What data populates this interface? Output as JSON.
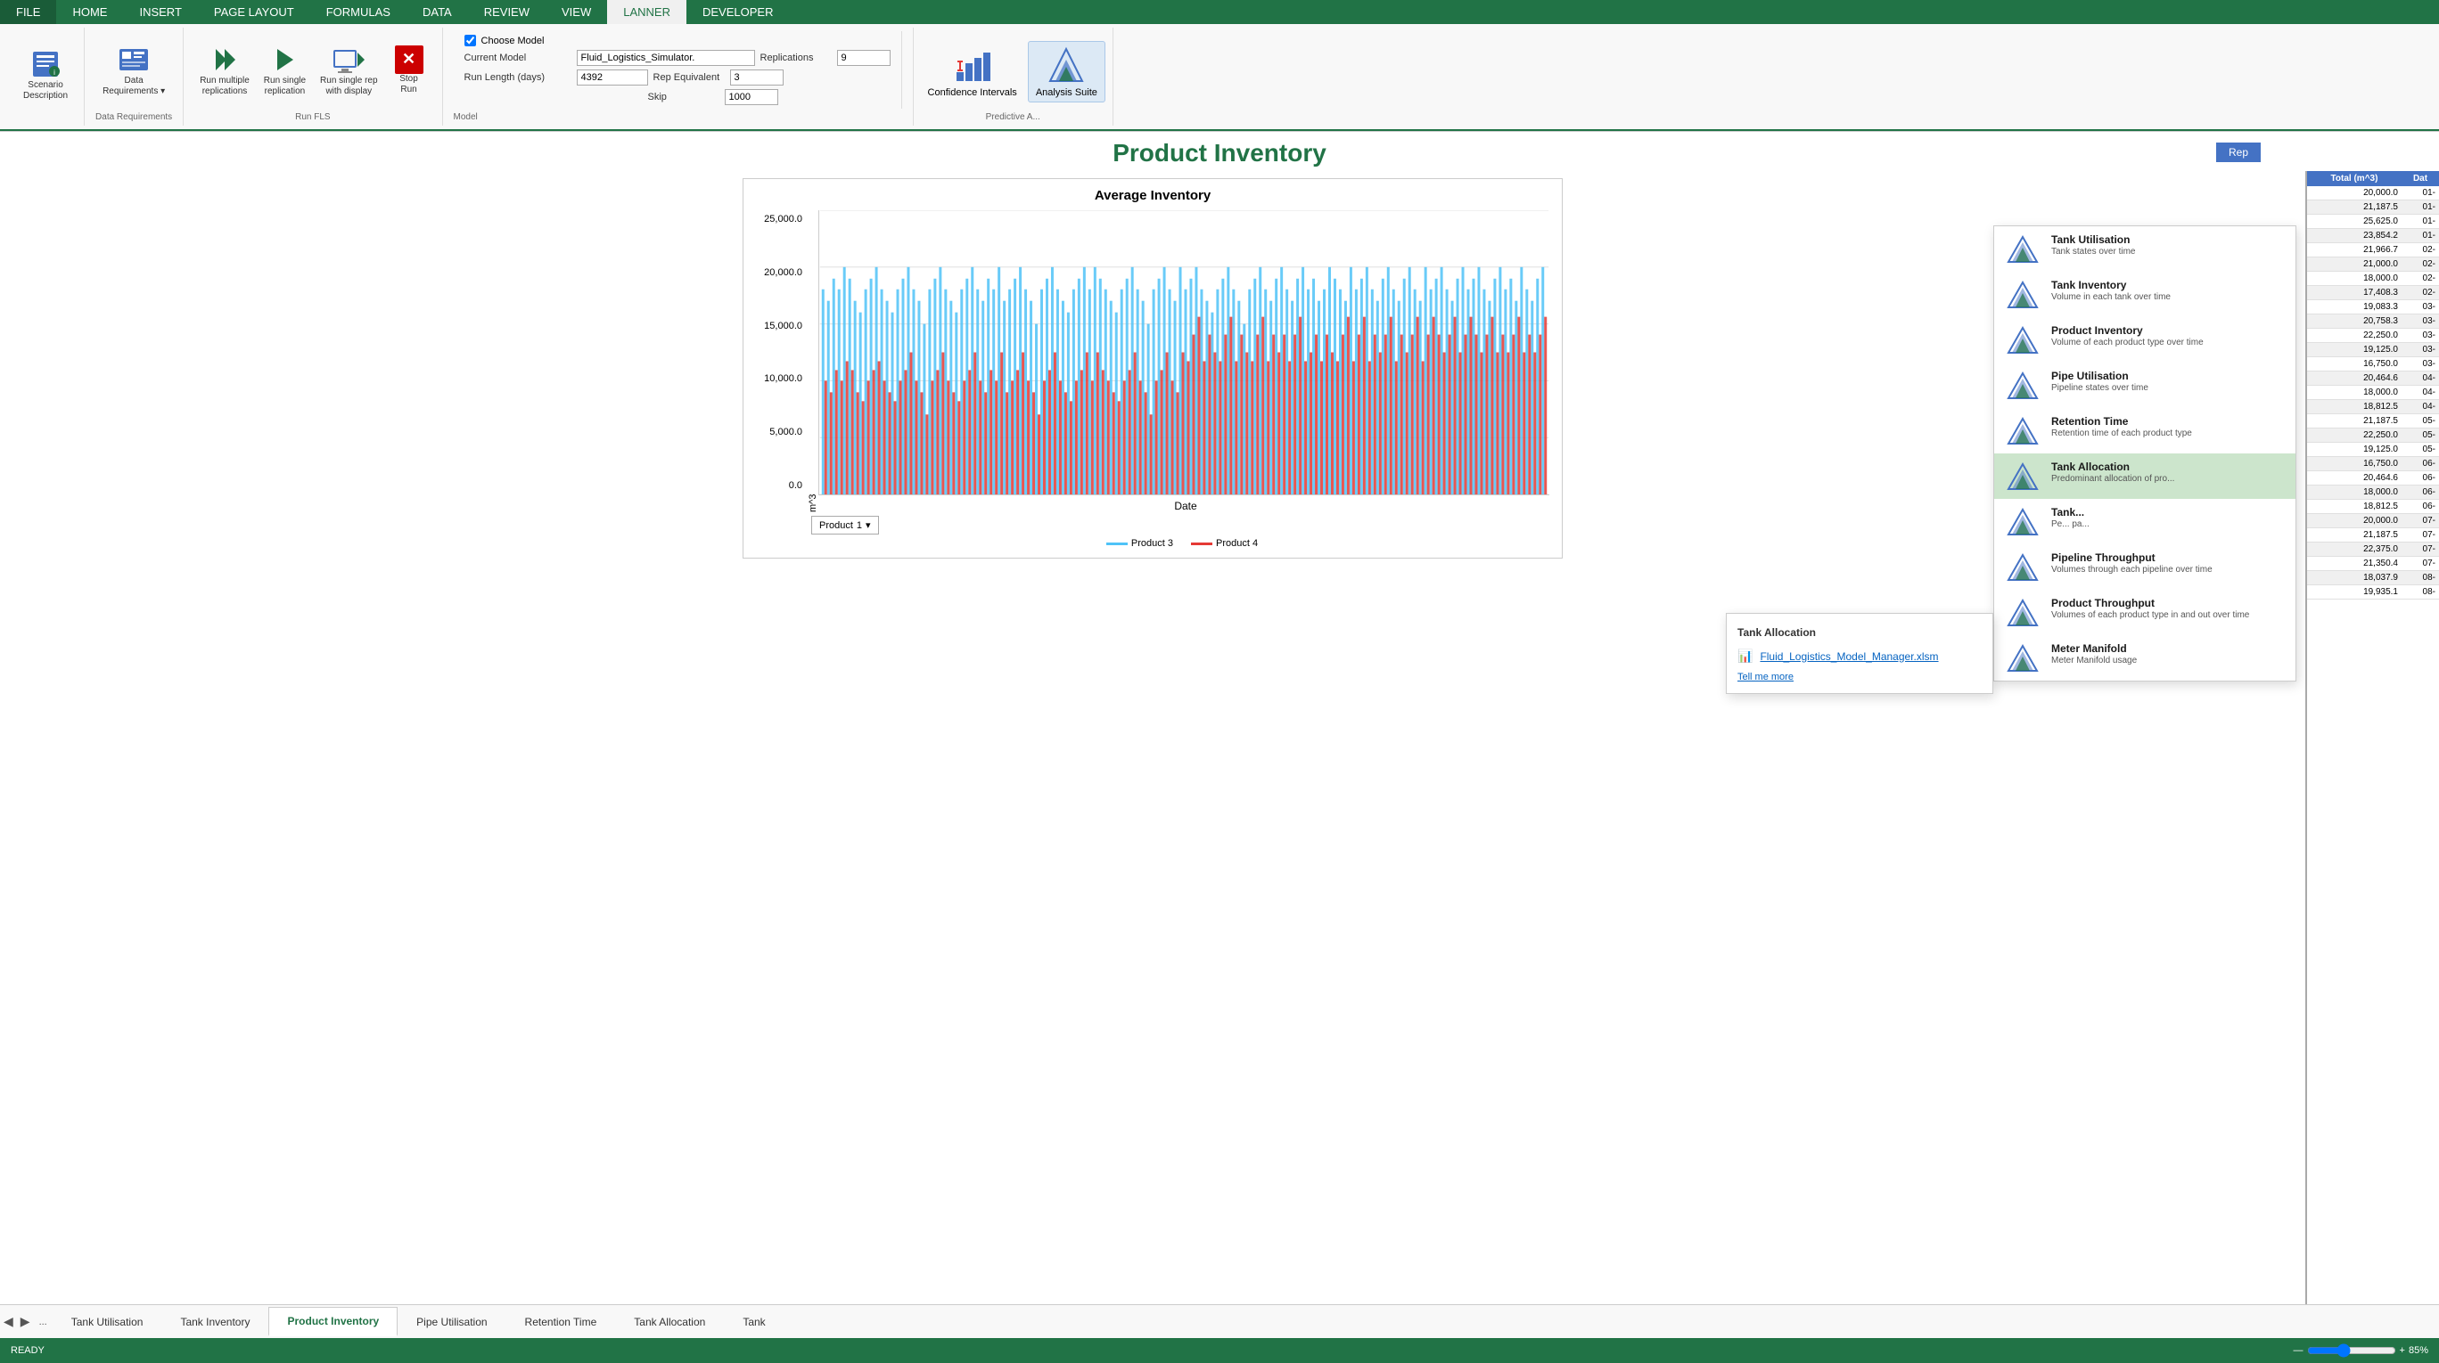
{
  "ribbon": {
    "tabs": [
      "FILE",
      "HOME",
      "INSERT",
      "PAGE LAYOUT",
      "FORMULAS",
      "DATA",
      "REVIEW",
      "VIEW",
      "LANNER",
      "DEVELOPER"
    ],
    "active_tab": "LANNER",
    "groups": {
      "scenario": {
        "label": "Scenario\nDescription",
        "group_label": ""
      },
      "data_req": {
        "label": "Data\nRequirements",
        "group_label": "Data Requirements"
      },
      "run_fls": {
        "buttons": [
          "Run multiple\nreplications",
          "Run single\nreplication",
          "Run single rep\nwith display",
          "Stop\nRun"
        ],
        "group_label": "Run FLS"
      },
      "model": {
        "choose_model": "Choose Model",
        "current_model_label": "Current Model",
        "current_model_value": "Fluid_Logistics_Simulator.",
        "rep_label": "Replications",
        "rep_value": "9",
        "rep_equiv_label": "Rep Equivalent",
        "rep_equiv_value": "3",
        "run_length_label": "Run Length (days)",
        "run_length_value": "4392",
        "skip_label": "Skip",
        "skip_value": "1000",
        "group_label": "Model"
      },
      "predictive": {
        "confidence_label": "Confidence\nIntervals",
        "analysis_label": "Analysis\nSuite",
        "group_label": "Predictive A..."
      }
    }
  },
  "page": {
    "title": "Product Inventory",
    "rep_button": "Rep"
  },
  "chart": {
    "title": "Average Inventory",
    "y_label": "m^3",
    "x_label": "Date",
    "y_ticks": [
      "25,000.0",
      "20,000.0",
      "15,000.0",
      "10,000.0",
      "5,000.0",
      "0.0"
    ],
    "legend": [
      {
        "label": "Product 3",
        "color": "#4fc3f7"
      },
      {
        "label": "Product 4",
        "color": "#e53935"
      }
    ],
    "product_filter_label": "Product",
    "product_filter_value": "1"
  },
  "data_table": {
    "headers": [
      "Total (m^3)",
      "Dat"
    ],
    "rows": [
      {
        "total": "20,000.0",
        "date": "01-"
      },
      {
        "total": "21,187.5",
        "date": "01-"
      },
      {
        "total": "25,625.0",
        "date": "01-"
      },
      {
        "total": "23,854.2",
        "date": "01-"
      },
      {
        "total": "21,966.7",
        "date": "02-"
      },
      {
        "total": "21,000.0",
        "date": "02-"
      },
      {
        "total": "18,000.0",
        "date": "02-"
      },
      {
        "total": "17,408.3",
        "date": "02-"
      },
      {
        "total": "19,083.3",
        "date": "03-"
      },
      {
        "total": "20,758.3",
        "date": "03-"
      },
      {
        "total": "22,250.0",
        "date": "03-"
      },
      {
        "total": "19,125.0",
        "date": "03-"
      },
      {
        "total": "16,750.0",
        "date": "03-"
      },
      {
        "total": "20,464.6",
        "date": "04-"
      },
      {
        "total": "18,000.0",
        "date": "04-"
      },
      {
        "total": "18,812.5",
        "date": "04-"
      },
      {
        "total": "21,187.5",
        "date": "05-"
      },
      {
        "total": "22,250.0",
        "date": "05-"
      },
      {
        "total": "19,125.0",
        "date": "05-"
      },
      {
        "total": "16,750.0",
        "date": "06-"
      },
      {
        "total": "20,464.6",
        "date": "06-"
      },
      {
        "total": "18,000.0",
        "date": "06-"
      },
      {
        "total": "18,812.5",
        "date": "06-"
      },
      {
        "total": "20,000.0",
        "date": "07-"
      },
      {
        "total": "21,187.5",
        "date": "07-"
      },
      {
        "total": "22,375.0",
        "date": "07-"
      },
      {
        "total": "21,350.4",
        "date": "07-"
      },
      {
        "total": "18,037.9",
        "date": "08-"
      },
      {
        "total": "19,935.1",
        "date": "08-"
      }
    ]
  },
  "analysis_menu": {
    "items": [
      {
        "title": "Tank Utilisation",
        "desc": "Tank states over time",
        "id": "tank-utilisation"
      },
      {
        "title": "Tank Inventory",
        "desc": "Volume in each tank over time",
        "id": "tank-inventory"
      },
      {
        "title": "Product Inventory",
        "desc": "Volume of each product type over time",
        "id": "product-inventory"
      },
      {
        "title": "Pipe Utilisation",
        "desc": "Pipeline states over time",
        "id": "pipe-utilisation"
      },
      {
        "title": "Retention Time",
        "desc": "Retention time of each product type",
        "id": "retention-time"
      },
      {
        "title": "Tank Allocation",
        "desc": "Predominant allocation of pro...",
        "id": "tank-allocation",
        "highlighted": true
      },
      {
        "title": "Tank...",
        "desc": "Pe... pa...",
        "id": "tank-extra"
      },
      {
        "title": "Pipeline Throughput",
        "desc": "Volumes through each pipeline over time",
        "id": "pipeline-throughput"
      },
      {
        "title": "Product Throughput",
        "desc": "Volumes of each product type in and out over time",
        "id": "product-throughput"
      },
      {
        "title": "Meter Manifold",
        "desc": "Meter Manifold usage",
        "id": "meter-manifold"
      }
    ]
  },
  "sub_popup": {
    "title": "Tank Allocation",
    "file_item": "Fluid_Logistics_Model_Manager.xlsm",
    "tell_me_more": "Tell me more"
  },
  "tabs": [
    {
      "label": "Tank Utilisation",
      "active": false
    },
    {
      "label": "Tank Inventory",
      "active": false
    },
    {
      "label": "Product Inventory",
      "active": true
    },
    {
      "label": "Pipe Utilisation",
      "active": false
    },
    {
      "label": "Retention Time",
      "active": false
    },
    {
      "label": "Tank Allocation",
      "active": false
    },
    {
      "label": "Tank",
      "active": false
    }
  ],
  "status_bar": {
    "ready": "READY",
    "zoom": "85%",
    "zoom_value": 85
  },
  "colors": {
    "excel_green": "#217346",
    "blue": "#4472c4",
    "product3": "#4fc3f7",
    "product4": "#e53935",
    "highlighted_green": "#cce5cc"
  }
}
